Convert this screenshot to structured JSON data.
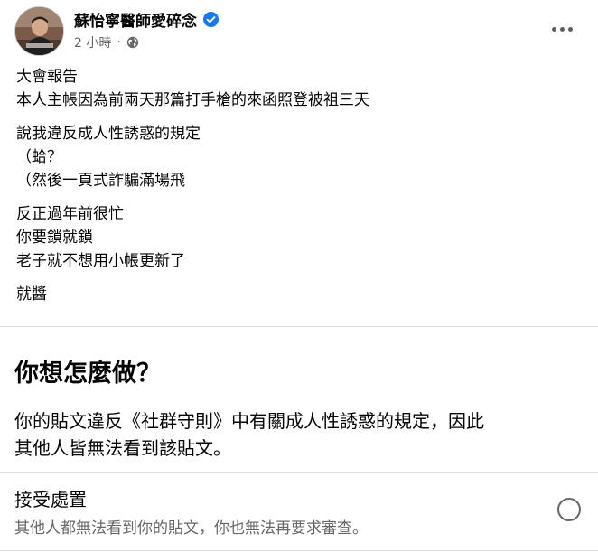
{
  "post": {
    "author": "蘇怡寧醫師愛碎念",
    "time": "2 小時",
    "separator": "·",
    "verified": true,
    "body": [
      [
        "大會報告",
        "本人主帳因為前兩天那篇打手槍的來函照登被祖三天"
      ],
      [
        "說我違反成人性誘惑的規定",
        "（蛤？",
        "（然後一頁式詐騙滿場飛"
      ],
      [
        "反正過年前很忙",
        "你要鎖就鎖",
        "老子就不想用小帳更新了"
      ],
      [
        "就醬"
      ]
    ]
  },
  "dialog": {
    "title": "你想怎麼做？",
    "description": [
      "你的貼文違反《社群守則》中有關成人性誘惑的規定，因此",
      "其他人皆無法看到該貼文。"
    ],
    "option": {
      "title": "接受處置",
      "description": "其他人都無法看到你的貼文，你也無法再要求審查。",
      "selected": false
    }
  },
  "icons": {
    "verified": "verified-badge-icon",
    "audience": "globe-icon",
    "more": "more-options-icon"
  },
  "colors": {
    "verified_badge": "#1877f2",
    "secondary_text": "#65676b",
    "divider": "#dadde1"
  }
}
